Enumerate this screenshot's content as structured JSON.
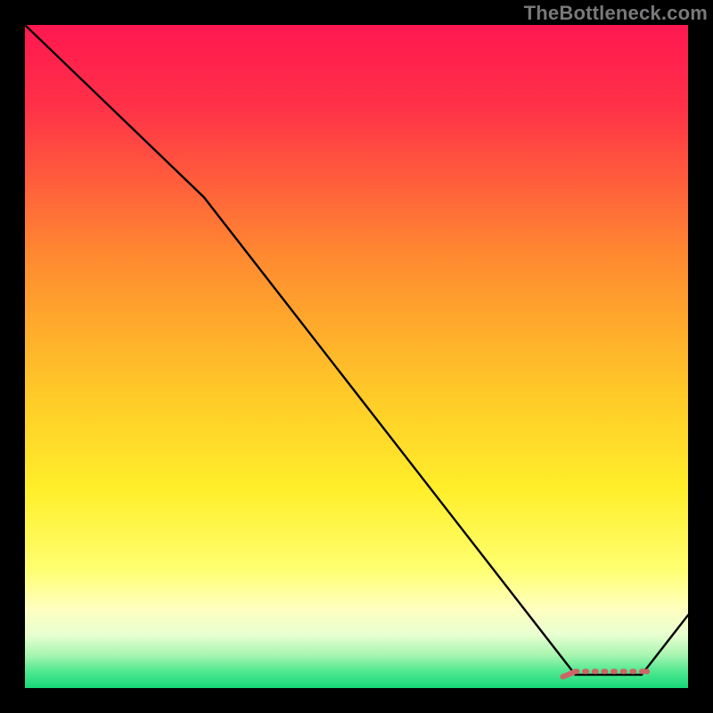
{
  "attribution": "TheBottleneck.com",
  "colors": {
    "background": "#000000",
    "grad_top": "#ff1850",
    "grad_orange": "#ff9a2a",
    "grad_yellow": "#ffee2a",
    "grad_pale": "#ffffa8",
    "grad_green": "#15e07a",
    "line": "#000000",
    "marker": "#cc6666"
  },
  "chart_data": {
    "type": "line",
    "title": "",
    "xlabel": "",
    "ylabel": "",
    "xlim": [
      0,
      100
    ],
    "ylim": [
      0,
      100
    ],
    "x": [
      0,
      27,
      83,
      93,
      100
    ],
    "y": [
      100,
      74,
      2,
      2,
      11
    ],
    "marker_segment": {
      "x": [
        83,
        93
      ],
      "y": [
        2.5,
        2.5
      ]
    },
    "annotations": []
  }
}
